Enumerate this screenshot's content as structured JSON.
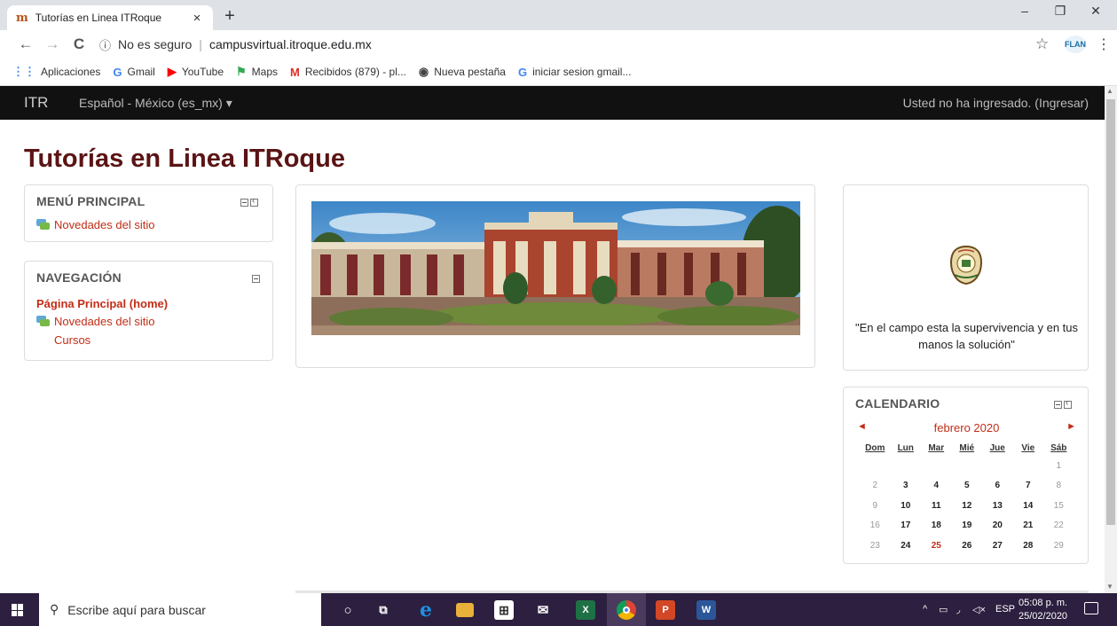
{
  "browser": {
    "tab_title": "Tutorías en Linea ITRoque",
    "tab_close": "×",
    "new_tab": "+",
    "window_controls": {
      "minimize": "–",
      "restore": "❐",
      "close": "✕"
    },
    "nav": {
      "back": "←",
      "forward": "→",
      "reload": "C"
    },
    "security_label": "No es seguro",
    "url": "campusvirtual.itroque.edu.mx",
    "bookmarks": [
      {
        "label": "Aplicaciones",
        "icon": "apps-icon",
        "glyph": "⋮⋮",
        "color": "#4285f4"
      },
      {
        "label": "Gmail",
        "icon": "google-icon",
        "glyph": "G",
        "color": "#4285f4"
      },
      {
        "label": "YouTube",
        "icon": "youtube-icon",
        "glyph": "▶",
        "color": "#ff0000"
      },
      {
        "label": "Maps",
        "icon": "maps-icon",
        "glyph": "⚑",
        "color": "#34a853"
      },
      {
        "label": "Recibidos (879) - pl...",
        "icon": "gmail-icon",
        "glyph": "M",
        "color": "#d93025"
      },
      {
        "label": "Nueva pestaña",
        "icon": "globe-icon",
        "glyph": "◉",
        "color": "#444"
      },
      {
        "label": "iniciar sesion gmail...",
        "icon": "google-icon",
        "glyph": "G",
        "color": "#4285f4"
      }
    ]
  },
  "site": {
    "brand": "ITR",
    "language": "Español - México (es_mx) ▾",
    "login_text": "Usted no ha ingresado. (Ingresar)",
    "page_title": "Tutorías en Linea ITRoque"
  },
  "menu_block": {
    "title": "MENÚ PRINCIPAL",
    "items": [
      {
        "label": "Novedades del sitio"
      }
    ]
  },
  "nav_block": {
    "title": "NAVEGACIÓN",
    "home": "Página Principal (home)",
    "news": "Novedades del sitio",
    "courses": "Cursos"
  },
  "quote_block": {
    "text": "\"En el campo esta la supervivencia  y en tus manos la solución\""
  },
  "calendar": {
    "title": "CALENDARIO",
    "prev": "◄",
    "next": "►",
    "month": "febrero 2020",
    "days": [
      "Dom",
      "Lun",
      "Mar",
      "Mié",
      "Jue",
      "Vie",
      "Sáb"
    ],
    "weeks": [
      [
        "",
        "",
        "",
        "",
        "",
        "",
        "1"
      ],
      [
        "2",
        "3",
        "4",
        "5",
        "6",
        "7",
        "8"
      ],
      [
        "9",
        "10",
        "11",
        "12",
        "13",
        "14",
        "15"
      ],
      [
        "16",
        "17",
        "18",
        "19",
        "20",
        "21",
        "22"
      ],
      [
        "23",
        "24",
        "25",
        "26",
        "27",
        "28",
        "29"
      ]
    ],
    "today": "25"
  },
  "taskbar": {
    "search_placeholder": "Escribe aquí para buscar",
    "tray": {
      "chevron": "^",
      "language": "ESP"
    },
    "time": "05:08 p. m.",
    "date": "25/02/2020"
  }
}
